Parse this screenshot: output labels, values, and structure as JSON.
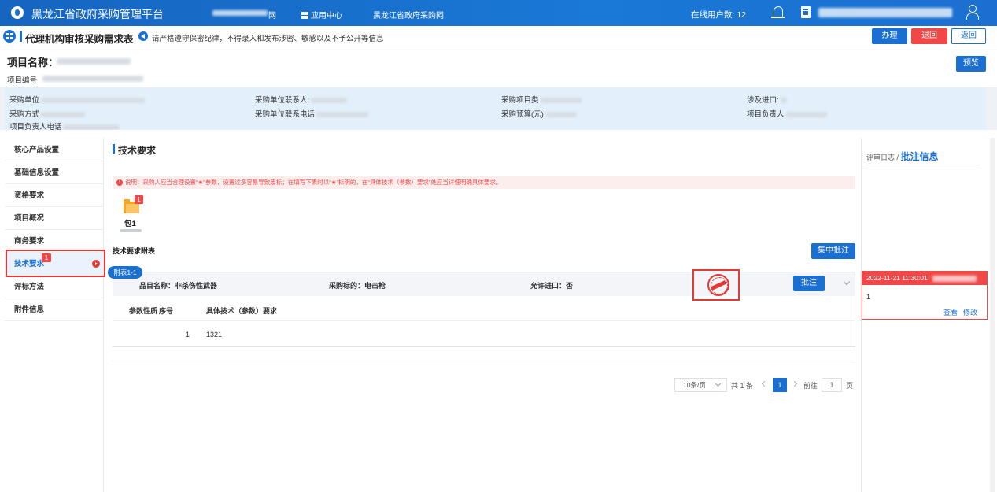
{
  "header": {
    "app_title": "黑龙江省政府采购管理平台",
    "nav_suffix": "网",
    "nav_app_center": "应用中心",
    "nav_procurement_site": "黑龙江省政府采购网",
    "online_label": "在线用户数: 12"
  },
  "titlebar": {
    "page_title": "代理机构审核采购需求表",
    "notice": "请严格遵守保密纪律，不得录入和发布涉密、敏感以及不予公开等信息",
    "btn_handle": "办理",
    "btn_reject": "退回",
    "btn_back": "返回"
  },
  "project": {
    "name_label": "项目名称：",
    "code_label": "项目编号",
    "preview_label": "预览"
  },
  "info": {
    "purchaser": "采购单位",
    "purchaser_contact": "采购单位联系人:",
    "procurement_project": "采购项目类",
    "import_involved": "涉及进口:",
    "method": "采购方式",
    "contact_phone": "采购单位联系电话",
    "budget": "采购预算(元)",
    "leader": "项目负责人",
    "leader_phone": "项目负责人电话"
  },
  "sidebar": {
    "items": [
      {
        "label": "核心产品设置"
      },
      {
        "label": "基础信息设置"
      },
      {
        "label": "资格要求"
      },
      {
        "label": "项目概况"
      },
      {
        "label": "商务要求"
      },
      {
        "label": "技术要求",
        "badge": "1"
      },
      {
        "label": "评标方法"
      },
      {
        "label": "附件信息"
      }
    ]
  },
  "main": {
    "title": "技术要求",
    "warning": "说明：采购人应当合理设置“★”参数，设置过多容易导致废标；在填写下表时以“★”标明的，在“具体技术（参数）要求”处应当详细明确具体要求。",
    "package_label": "包1",
    "package_badge": "1",
    "attach_label": "技术要求附表",
    "batch_annotate": "集中批注",
    "table": {
      "tab_label": "附表1-1",
      "item_name": "品目名称：非杀伤性武器",
      "subject": "采购标的：电击枪",
      "import_allowed": "允许进口：否",
      "annotate_btn": "批注",
      "columns": [
        "参数性质",
        "序号",
        "具体技术（参数）要求"
      ],
      "rows": [
        {
          "nature": "",
          "index": "1",
          "requirement": "1321"
        }
      ]
    },
    "pagination": {
      "page_size": "10条/页",
      "total": "共 1 条",
      "current": "1",
      "goto_label": "前往",
      "goto_value": "1",
      "page_unit": "页"
    }
  },
  "right_panel": {
    "log_label": "评审日志 /",
    "annotation_label": "批注信息",
    "log": {
      "time": "2022-11-21 11:30:01",
      "content": "1",
      "view": "查看",
      "edit": "修改"
    }
  },
  "colors": {
    "primary": "#1a6fd0",
    "danger": "#f04848",
    "info_bg": "#e3f0fc"
  }
}
